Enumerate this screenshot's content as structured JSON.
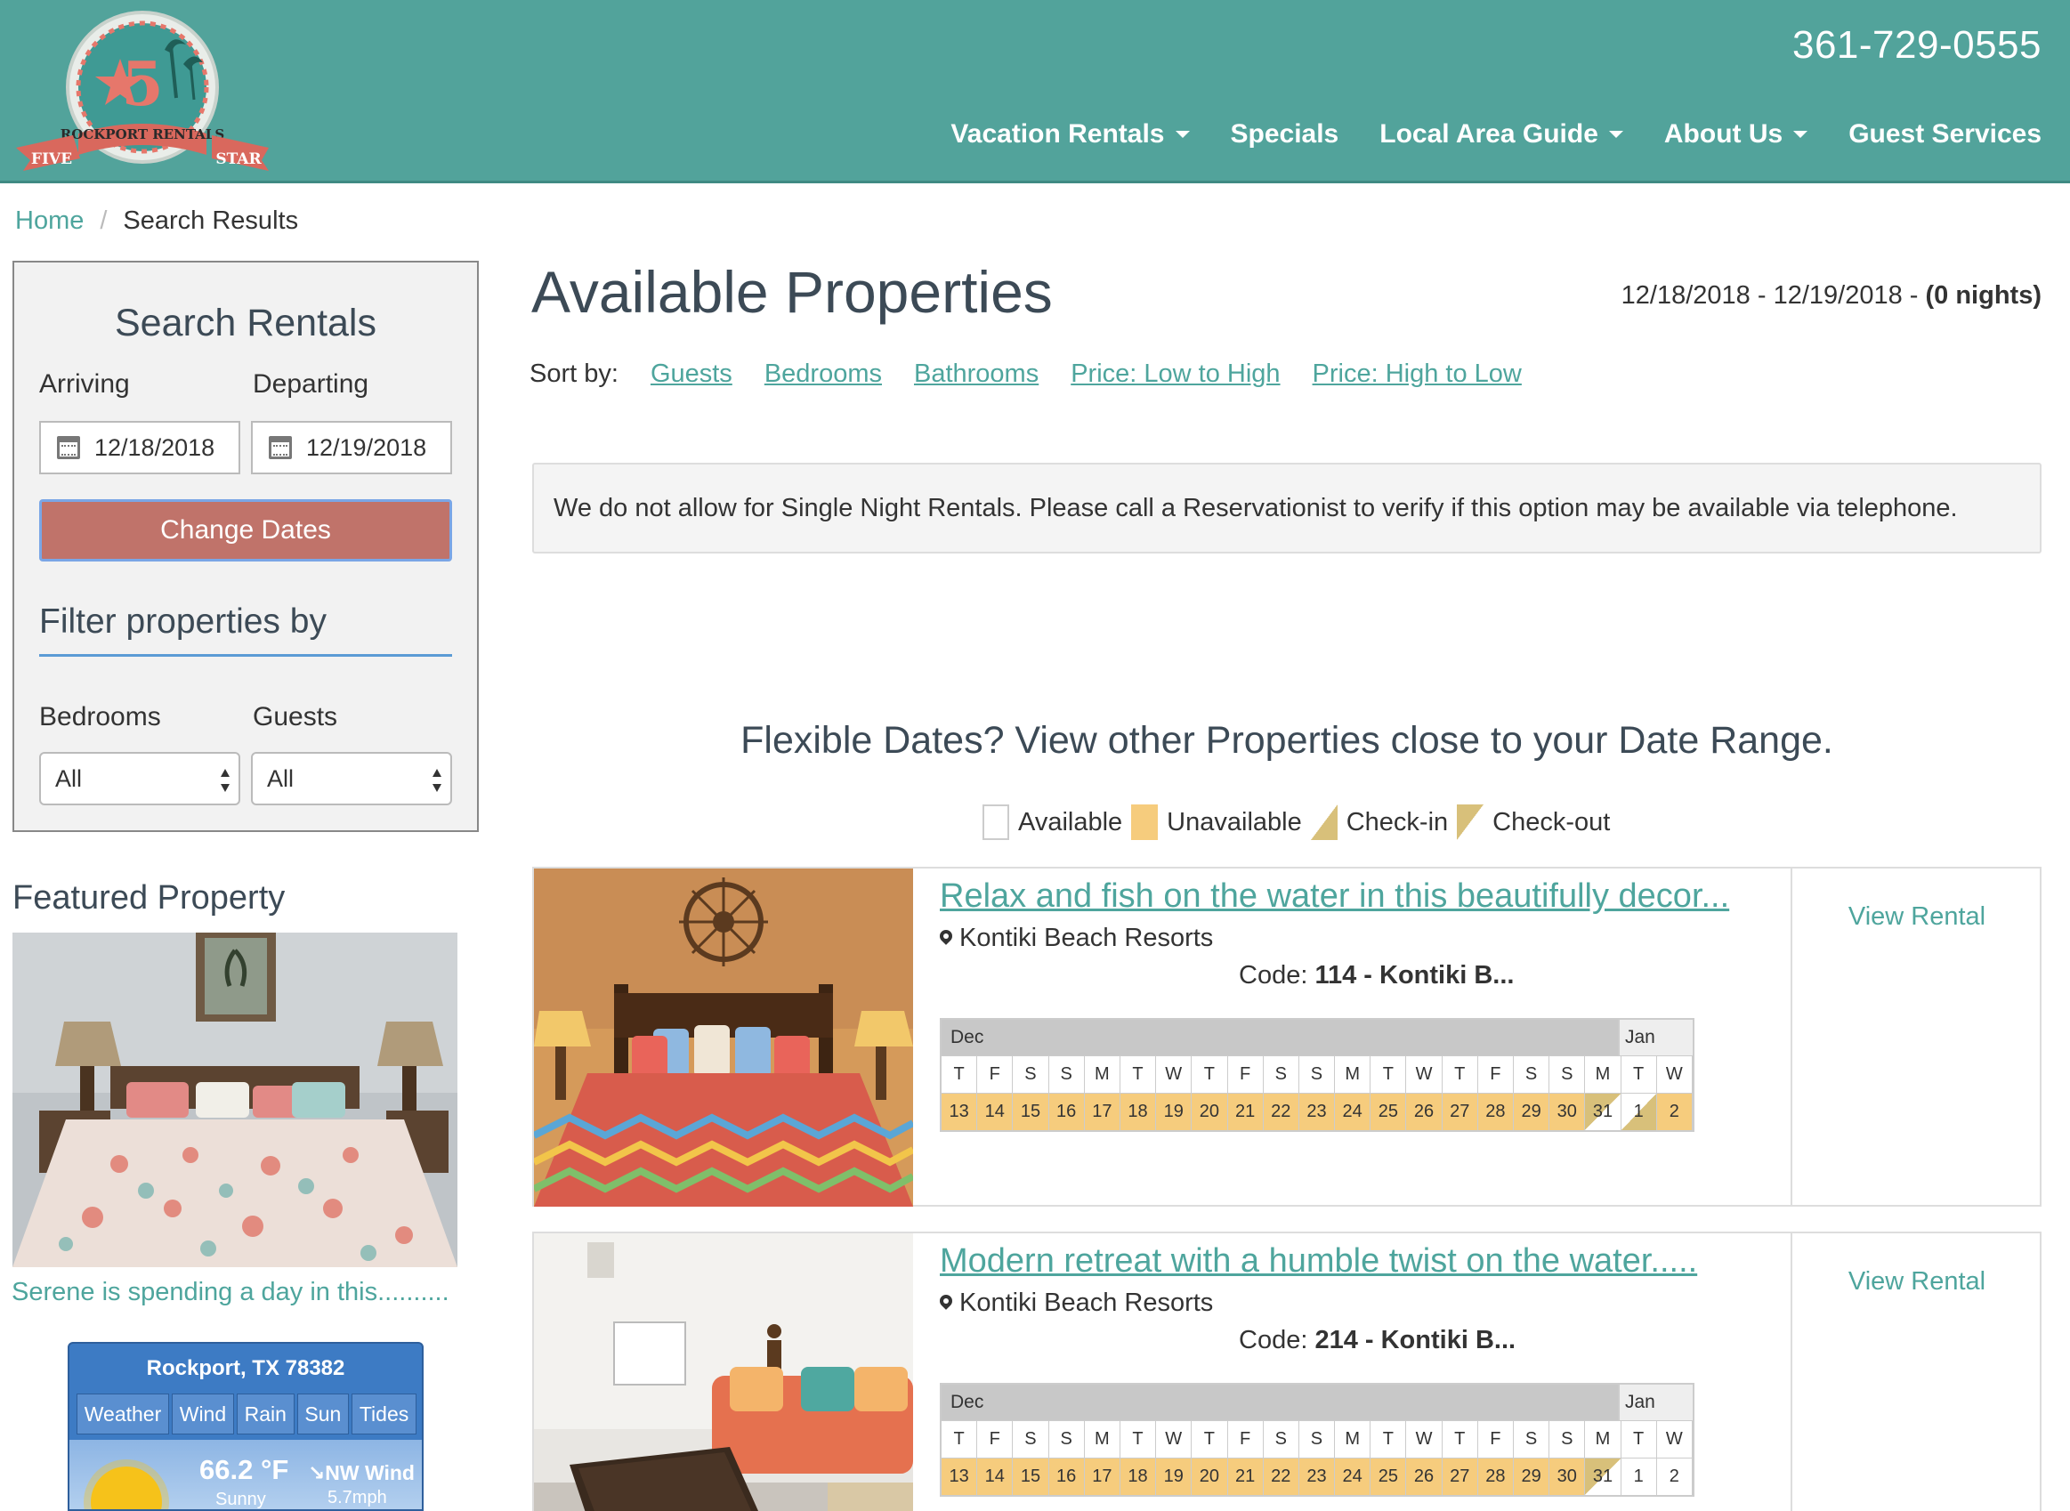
{
  "header": {
    "logo": {
      "top": "5",
      "middle": "ROCKPORT RENTALS",
      "left": "FIVE",
      "right": "STAR"
    },
    "phone": "361-729-0555",
    "nav": [
      {
        "label": "Vacation Rentals",
        "dropdown": true
      },
      {
        "label": "Specials",
        "dropdown": false
      },
      {
        "label": "Local Area Guide",
        "dropdown": true
      },
      {
        "label": "About Us",
        "dropdown": true
      },
      {
        "label": "Guest Services",
        "dropdown": false
      }
    ],
    "colors": {
      "brand": "#52a39b",
      "accent_button": "#c0736a"
    }
  },
  "breadcrumb": {
    "home": "Home",
    "sep": "/",
    "current": "Search Results"
  },
  "search": {
    "title": "Search Rentals",
    "arriving_label": "Arriving",
    "departing_label": "Departing",
    "arriving_value": "12/18/2018",
    "departing_value": "12/19/2018",
    "button": "Change Dates",
    "filter_title": "Filter properties by",
    "bedrooms_label": "Bedrooms",
    "guests_label": "Guests",
    "bedrooms_value": "All",
    "guests_value": "All"
  },
  "featured": {
    "title": "Featured Property",
    "caption": "Serene is spending a day in this.........."
  },
  "weather": {
    "location": "Rockport, TX 78382",
    "tabs": [
      "Weather",
      "Wind",
      "Rain",
      "Sun",
      "Tides"
    ],
    "temp": "66.2 °F",
    "condition": "Sunny",
    "wind": "NW Wind",
    "wind_speed": "5.7mph"
  },
  "main": {
    "title": "Available Properties",
    "date_range": "12/18/2018 - 12/19/2018 - ",
    "nights": "(0 nights)",
    "sort_label": "Sort by:",
    "sort_options": [
      "Guests",
      "Bedrooms",
      "Bathrooms",
      "Price: Low to High",
      "Price: High to Low"
    ],
    "alert": "We do not allow for Single Night Rentals. Please call a Reservationist to verify if this option may be available via telephone.",
    "flex_title": "Flexible Dates? View other Properties close to your Date Range.",
    "legend": [
      "Available",
      "Unavailable",
      "Check-in",
      "Check-out"
    ]
  },
  "calendar": {
    "month1": "Dec",
    "month2": "Jan",
    "weekdays": [
      "T",
      "F",
      "S",
      "S",
      "M",
      "T",
      "W",
      "T",
      "F",
      "S",
      "S",
      "M",
      "T",
      "W",
      "T",
      "F",
      "S",
      "S",
      "M",
      "T",
      "W"
    ],
    "dates": [
      "13",
      "14",
      "15",
      "16",
      "17",
      "18",
      "19",
      "20",
      "21",
      "22",
      "23",
      "24",
      "25",
      "26",
      "27",
      "28",
      "29",
      "30",
      "31",
      "1",
      "2"
    ]
  },
  "properties": [
    {
      "title": "Relax and fish on the water in this beautifully decor...",
      "location": "Kontiki Beach Resorts",
      "code_label": "Code: ",
      "code": "114 - Kontiki B...",
      "view": "View Rental",
      "availability": [
        "u",
        "u",
        "u",
        "u",
        "u",
        "u",
        "u",
        "u",
        "u",
        "u",
        "u",
        "u",
        "u",
        "u",
        "u",
        "u",
        "u",
        "u",
        "co",
        "ci",
        "u"
      ]
    },
    {
      "title": "Modern retreat with a humble twist on the water.....",
      "location": "Kontiki Beach Resorts",
      "code_label": "Code: ",
      "code": "214 - Kontiki B...",
      "view": "View Rental",
      "availability": [
        "u",
        "u",
        "u",
        "u",
        "u",
        "u",
        "u",
        "u",
        "u",
        "u",
        "u",
        "u",
        "u",
        "u",
        "u",
        "u",
        "u",
        "u",
        "co",
        "a",
        "a"
      ]
    }
  ]
}
